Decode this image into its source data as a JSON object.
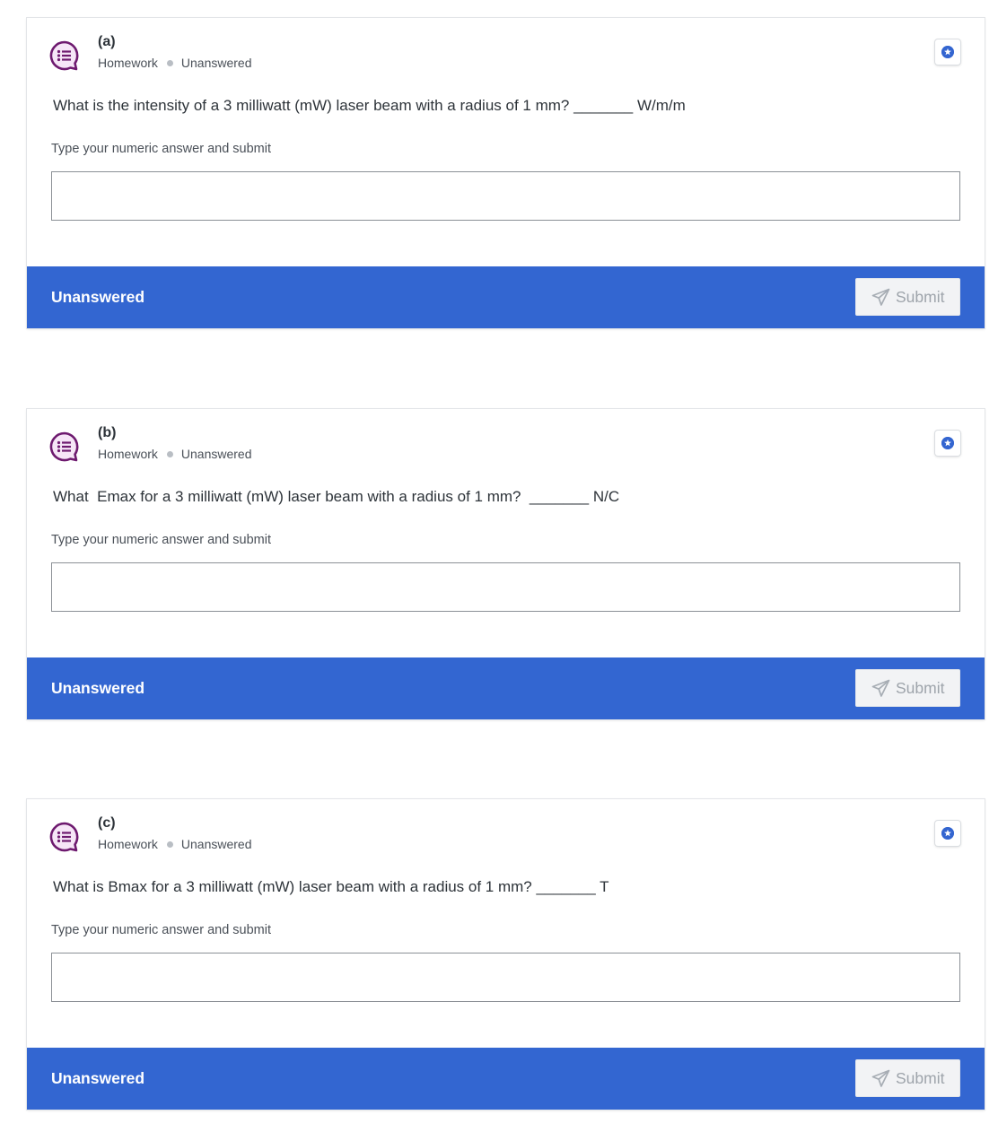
{
  "cards": [
    {
      "title": "(a)",
      "category": "Homework",
      "state": "Unanswered",
      "question": "What is the intensity of a 3 milliwatt (mW) laser beam with a radius of 1 mm? _______ W/m/m",
      "instruction": "Type your numeric answer and submit",
      "answer_value": "",
      "footer_status": "Unanswered",
      "submit_label": "Submit"
    },
    {
      "title": "(b)",
      "category": "Homework",
      "state": "Unanswered",
      "question": "What  Emax for a 3 milliwatt (mW) laser beam with a radius of 1 mm?  _______ N/C",
      "instruction": "Type your numeric answer and submit",
      "answer_value": "",
      "footer_status": "Unanswered",
      "submit_label": "Submit"
    },
    {
      "title": "(c)",
      "category": "Homework",
      "state": "Unanswered",
      "question": "What is Bmax for a 3 milliwatt (mW) laser beam with a radius of 1 mm? _______ T",
      "instruction": "Type your numeric answer and submit",
      "answer_value": "",
      "footer_status": "Unanswered",
      "submit_label": "Submit"
    }
  ],
  "icons": {
    "question_type": "numeric-question-icon",
    "star": "star-icon",
    "send": "send-icon"
  },
  "colors": {
    "accent": "#3366d1",
    "icon_purple": "#6e1a6f",
    "submit_disabled_text": "#9ea4ab"
  }
}
